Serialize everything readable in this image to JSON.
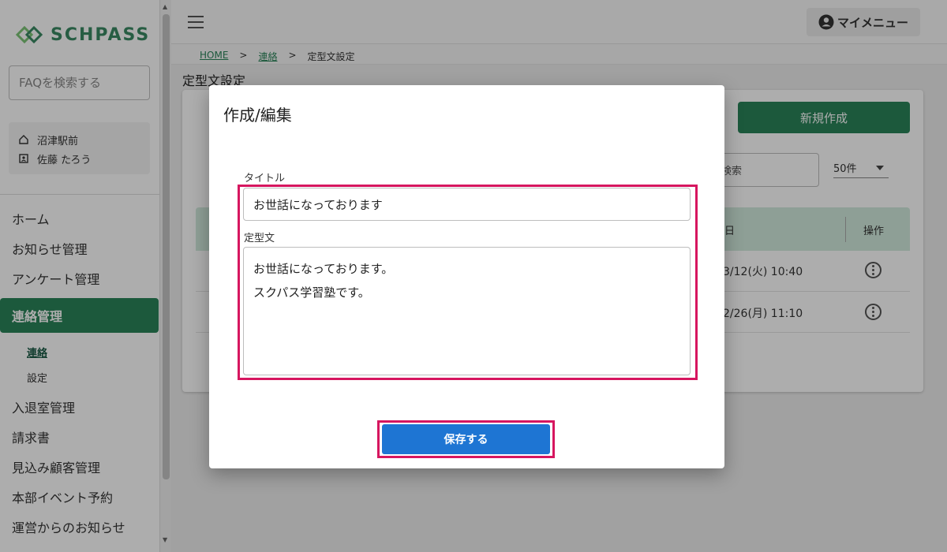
{
  "brand": {
    "logo_text": "SCHPASS"
  },
  "sidebar": {
    "faq_placeholder": "FAQを検索する",
    "school": "沼津駅前",
    "user": "佐藤 たろう",
    "nav": {
      "home": "ホーム",
      "notice": "お知らせ管理",
      "survey": "アンケート管理",
      "contact": "連絡管理",
      "contact_sub_1": "連絡",
      "contact_sub_2": "設定",
      "attendance": "入退室管理",
      "invoice": "請求書",
      "prospects": "見込み顧客管理",
      "hq_events": "本部イベント予約",
      "ops_notice": "運営からのお知らせ"
    }
  },
  "header": {
    "mymenu": "マイメニュー"
  },
  "breadcrumb": {
    "home": "HOME",
    "contact": "連絡",
    "current": "定型文設定",
    "sep": ">"
  },
  "page": {
    "title": "定型文設定",
    "new_button": "新規作成",
    "search_placeholder": "検索",
    "per_page": "50件",
    "col_date": "日",
    "col_op": "操作",
    "rows": [
      {
        "date": "3/12(火) 10:40"
      },
      {
        "date": "2/26(月) 11:10"
      }
    ]
  },
  "modal": {
    "title": "作成/編集",
    "label_title": "タイトル",
    "title_value": "お世話になっております",
    "label_body": "定型文",
    "body_line_1": "お世話になっております。",
    "body_line_2": "スクパス学習塾です。",
    "save": "保存する"
  },
  "colors": {
    "brand_green": "#2a8459",
    "highlight": "#d6165f",
    "save_blue": "#1e75d3"
  }
}
